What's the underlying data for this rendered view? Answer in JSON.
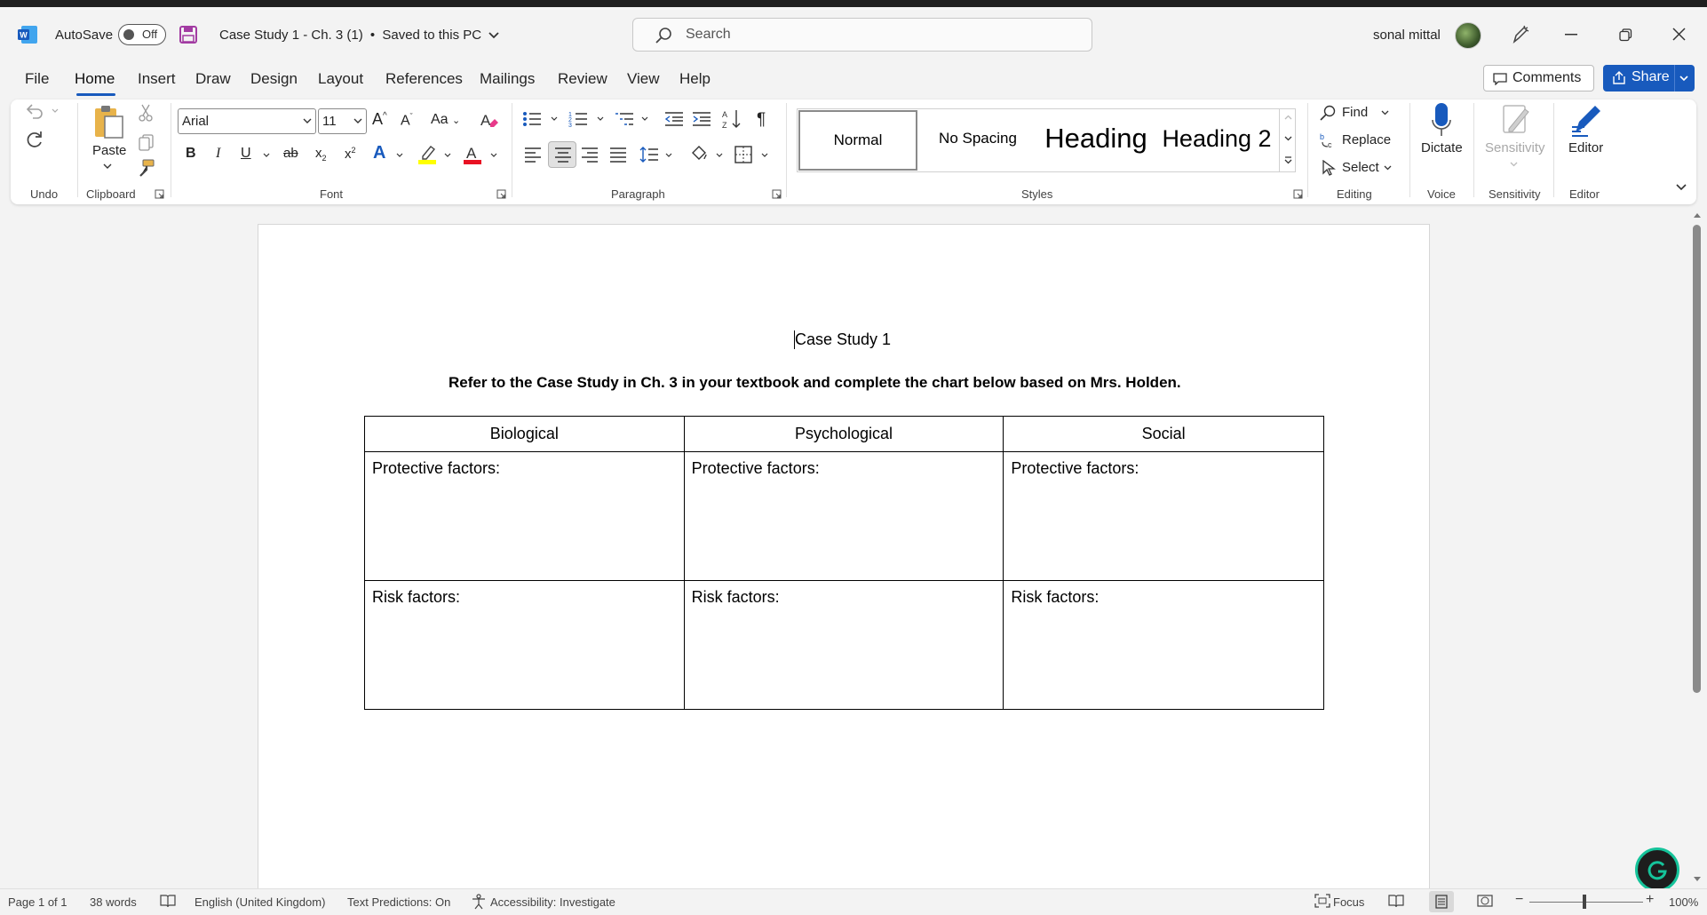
{
  "app": {
    "autosave_label": "AutoSave",
    "autosave_state": "Off",
    "doc_title": "Case Study 1 - Ch. 3 (1)",
    "save_status": "Saved to this PC",
    "search_placeholder": "Search",
    "user_name": "sonal mittal"
  },
  "tabs": [
    "File",
    "Home",
    "Insert",
    "Draw",
    "Design",
    "Layout",
    "References",
    "Mailings",
    "Review",
    "View",
    "Help"
  ],
  "active_tab": "Home",
  "actions": {
    "comments": "Comments",
    "share": "Share"
  },
  "ribbon": {
    "groups": {
      "undo": "Undo",
      "clipboard": "Clipboard",
      "font": "Font",
      "paragraph": "Paragraph",
      "styles": "Styles",
      "editing": "Editing",
      "voice": "Voice",
      "sensitivity": "Sensitivity",
      "editor": "Editor"
    },
    "paste_label": "Paste",
    "font_name": "Arial",
    "font_size": "11",
    "case_label": "Aa",
    "styles": [
      "Normal",
      "No Spacing",
      "Heading",
      "Heading 2"
    ],
    "find": "Find",
    "replace": "Replace",
    "select": "Select",
    "dictate": "Dictate",
    "sensitivity": "Sensitivity",
    "editor": "Editor",
    "accent_color": "#185abd",
    "highlight_color": "#ffff00",
    "font_color": "#e81123"
  },
  "document": {
    "title": "Case Study 1",
    "instruction": "Refer to the Case Study in Ch. 3 in your textbook and complete the chart below based on Mrs. Holden.",
    "table": {
      "headers": [
        "Biological",
        "Psychological",
        "Social"
      ],
      "rows": [
        [
          "Protective factors:",
          "Protective factors:",
          "Protective factors:"
        ],
        [
          "Risk factors:",
          "Risk factors:",
          "Risk factors:"
        ]
      ]
    }
  },
  "status": {
    "page": "Page 1 of 1",
    "words": "38 words",
    "language": "English (United Kingdom)",
    "predictions": "Text Predictions: On",
    "accessibility": "Accessibility: Investigate",
    "focus": "Focus",
    "zoom": "100%"
  }
}
